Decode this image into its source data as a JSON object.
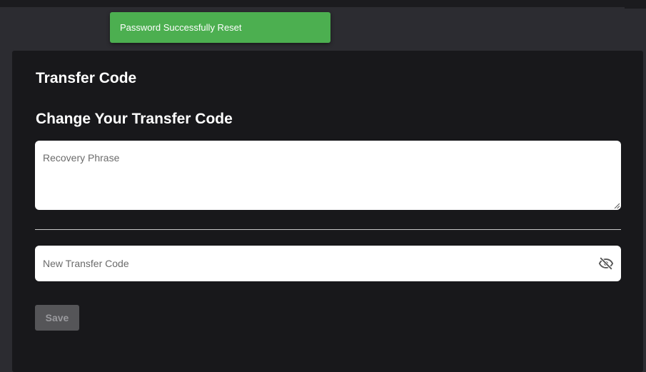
{
  "toast": {
    "message": "Password Successfully Reset",
    "color": "#4caf50"
  },
  "card": {
    "title": "Transfer Code",
    "section_title": "Change Your Transfer Code"
  },
  "form": {
    "recovery_phrase": {
      "placeholder": "Recovery Phrase",
      "value": ""
    },
    "new_transfer_code": {
      "placeholder": "New Transfer Code",
      "value": "",
      "toggle_icon": "eye-off-icon"
    },
    "save_label": "Save"
  }
}
